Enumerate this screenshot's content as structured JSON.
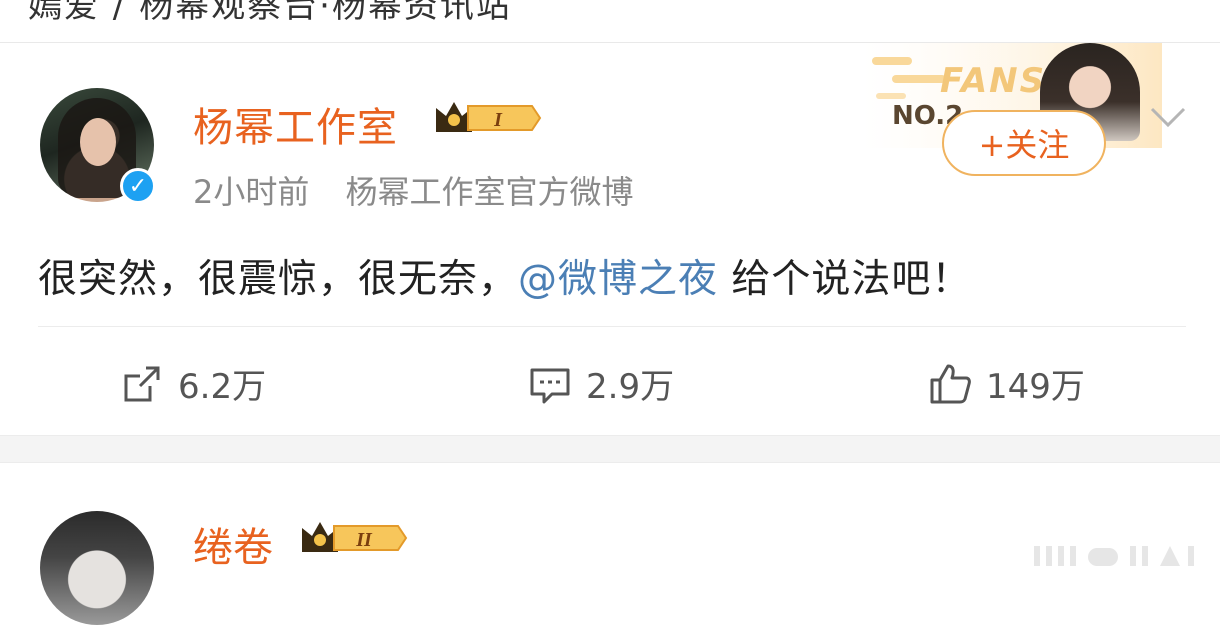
{
  "prev_post": {
    "cut_text": "嫣爱 / 杨幂观察台·杨幂资讯站"
  },
  "post": {
    "username": "杨幂工作室",
    "level_badge": "I",
    "time": "2小时前",
    "source": "杨幂工作室官方微博",
    "content_text": "很突然，很震惊，很无奈，",
    "mention": "@微博之夜",
    "content_tail": " 给个说法吧！",
    "fans_label": "FANS",
    "fans_rank": "NO.2",
    "follow_label": "+关注",
    "actions": {
      "repost_count": "6.2万",
      "comment_count": "2.9万",
      "like_count": "149万"
    }
  },
  "next_post": {
    "username": "绻卷",
    "level_badge": "II"
  },
  "colors": {
    "username": "#e8621f",
    "mention": "#4b7fb5",
    "verified": "#1da1f2",
    "gold": "#f0b35f"
  },
  "icons": [
    "verified-icon",
    "crown-badge-icon",
    "chevron-down-icon",
    "repost-icon",
    "comment-icon",
    "like-icon"
  ]
}
